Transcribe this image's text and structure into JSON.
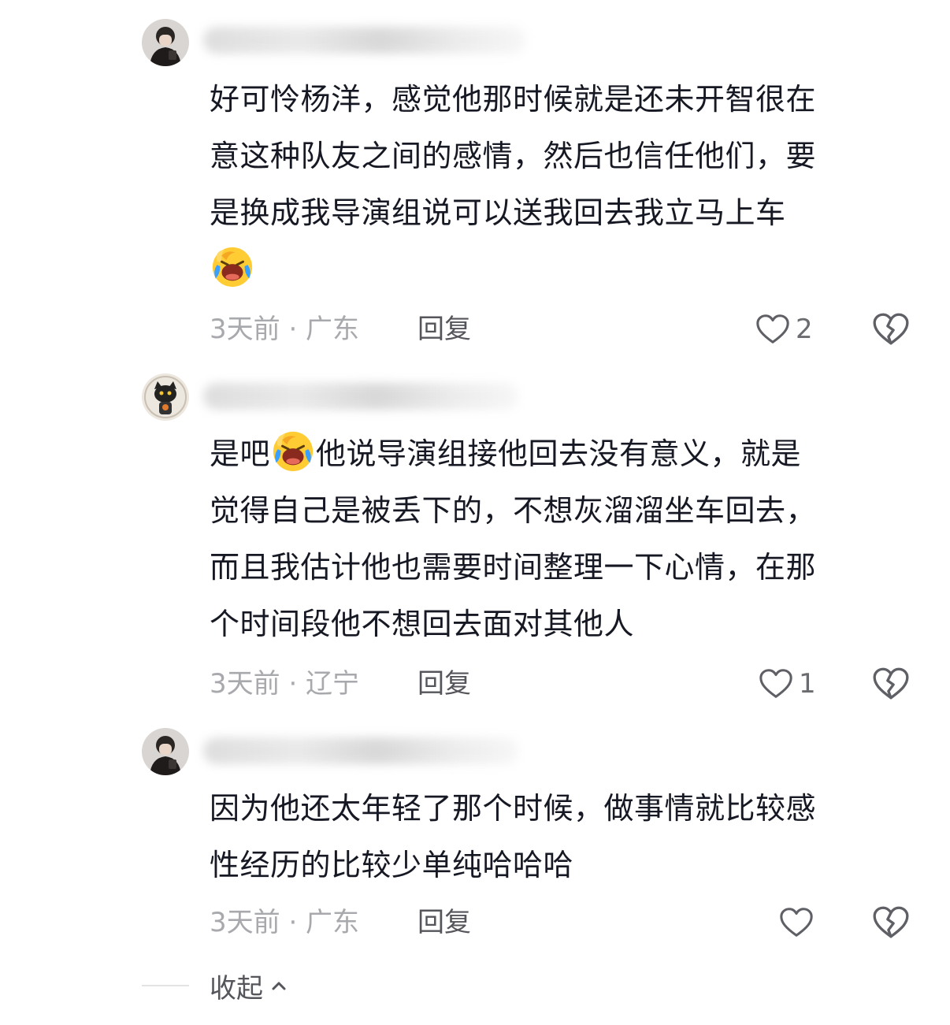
{
  "comments": [
    {
      "line1": "好可怜杨洋，感觉他那时候就是还未开智很在",
      "line2": "意这种队友之间的感情，然后也信任他们，要",
      "line3": "是换成我导演组说可以送我回去我立马上车",
      "emoji": "crying-laughing-emoji",
      "time_location": "3天前 · 广东",
      "reply_label": "回复",
      "like_count": "2"
    },
    {
      "line1_before": "是吧",
      "line1_after": "他说导演组接他回去没有意义，就是",
      "line2": "觉得自己是被丢下的，不想灰溜溜坐车回去，",
      "line3": "而且我估计他也需要时间整理一下心情，在那",
      "line4": "个时间段他不想回去面对其他人",
      "emoji": "crying-laughing-emoji",
      "time_location": "3天前 · 辽宁",
      "reply_label": "回复",
      "like_count": "1"
    },
    {
      "line1": "因为他还太年轻了那个时候，做事情就比较感",
      "line2": "性经历的比较少单纯哈哈哈",
      "time_location": "3天前 · 广东",
      "reply_label": "回复",
      "like_count": ""
    }
  ],
  "collapse_label": "收起",
  "colors": {
    "text": "#161823",
    "meta": "#a8a9ad",
    "action": "#55565b",
    "icon_stroke": "#5f6066",
    "emoji_face": "#ffcc33",
    "emoji_tear": "#3aa0ff"
  }
}
